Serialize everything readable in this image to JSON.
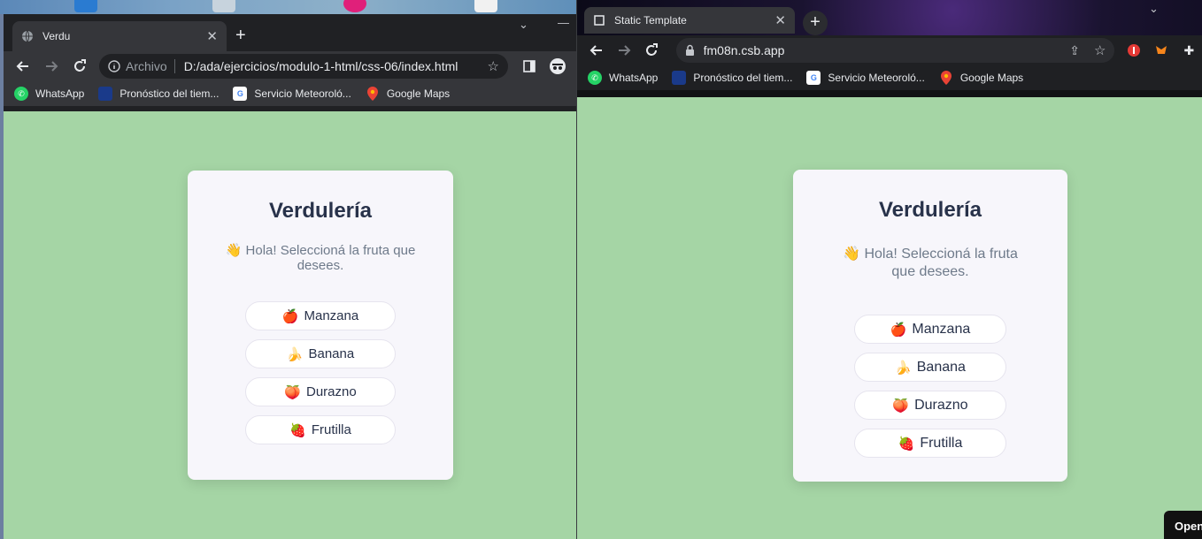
{
  "left_window": {
    "tab": {
      "title": "Verdu"
    },
    "omnibox": {
      "security_label": "Archivo",
      "url": "D:/ada/ejercicios/modulo-1-html/css-06/index.html"
    },
    "bookmarks": [
      {
        "label": "WhatsApp"
      },
      {
        "label": "Pronóstico del tiem..."
      },
      {
        "label": "Servicio Meteoroló..."
      },
      {
        "label": "Google Maps"
      }
    ],
    "page": {
      "title": "Verdulería",
      "greeting": "👋 Hola! Seleccioná la fruta que desees.",
      "fruits": [
        {
          "emoji": "🍎",
          "label": "Manzana"
        },
        {
          "emoji": "🍌",
          "label": "Banana"
        },
        {
          "emoji": "🍑",
          "label": "Durazno"
        },
        {
          "emoji": "🍓",
          "label": "Frutilla"
        }
      ]
    }
  },
  "right_window": {
    "tab": {
      "title": "Static Template"
    },
    "omnibox": {
      "url": "fm08n.csb.app"
    },
    "bookmarks": [
      {
        "label": "WhatsApp"
      },
      {
        "label": "Pronóstico del tiem..."
      },
      {
        "label": "Servicio Meteoroló..."
      },
      {
        "label": "Google Maps"
      }
    ],
    "page": {
      "title": "Verdulería",
      "greeting": "👋 Hola! Seleccioná la fruta que desees.",
      "fruits": [
        {
          "emoji": "🍎",
          "label": "Manzana"
        },
        {
          "emoji": "🍌",
          "label": "Banana"
        },
        {
          "emoji": "🍑",
          "label": "Durazno"
        },
        {
          "emoji": "🍓",
          "label": "Frutilla"
        }
      ]
    },
    "open_button": "Open"
  },
  "colors": {
    "page_background": "#a5d5a5",
    "card_background": "#f7f6fb",
    "title_color": "#28324a",
    "text_muted": "#6e7a8a",
    "chrome_dark": "#202124"
  },
  "icons": {
    "back": "arrow-left-icon",
    "forward": "arrow-right-icon",
    "reload": "reload-icon",
    "star": "star-icon",
    "info": "info-icon",
    "lock": "lock-icon"
  }
}
